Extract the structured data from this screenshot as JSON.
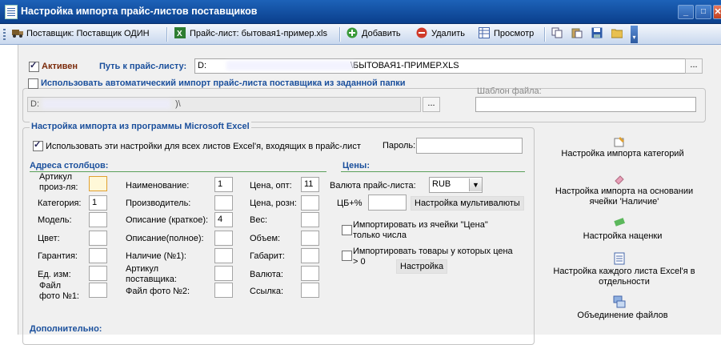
{
  "window": {
    "title": "Настройка импорта прайс-листов поставщиков",
    "buttons": [
      "_",
      "□",
      "✕"
    ]
  },
  "toolbar": {
    "supplier": "Поставщик: Поставщик ОДИН",
    "pricelist": "Прайс-лист: бытовая1-пример.xls",
    "add": "Добавить",
    "delete": "Удалить",
    "preview": "Просмотр"
  },
  "top": {
    "active_label": "Активен",
    "path_label": "Путь к прайс-листу:",
    "path_value_prefix": "D:",
    "path_value_suffix": "\\БЫТОВАЯ1-ПРИМЕР.XLS",
    "browse": "...",
    "auto_import_label": "Использовать автоматический импорт прайс-листа поставщика из заданной папки",
    "folder_value_prefix": "D:",
    "folder_value_suffix": ")\\",
    "template_label": "Шаблон файла:"
  },
  "excel": {
    "group_title": "Настройка импорта из программы Microsoft Excel",
    "use_all_label": "Использовать эти настройки для всех листов Excel'я, входящих в прайс-лист",
    "password_label": "Пароль:",
    "columns_title": "Адреса столбцов:",
    "fields": [
      {
        "label": "Артикул произ-ля:",
        "value": ""
      },
      {
        "label": "Категория:",
        "value": "1"
      },
      {
        "label": "Модель:",
        "value": ""
      },
      {
        "label": "Цвет:",
        "value": ""
      },
      {
        "label": "Гарантия:",
        "value": ""
      },
      {
        "label": "Ед. изм:",
        "value": ""
      },
      {
        "label": "Файл фото №1:",
        "value": ""
      },
      {
        "label": "Наименование:",
        "value": "1"
      },
      {
        "label": "Производитель:",
        "value": ""
      },
      {
        "label": "Описание (краткое):",
        "value": "4"
      },
      {
        "label": "Описание(полное):",
        "value": ""
      },
      {
        "label": "Наличие (№1):",
        "value": ""
      },
      {
        "label": "Артикул поставщика:",
        "value": ""
      },
      {
        "label": "Файл фото №2:",
        "value": ""
      },
      {
        "label": "Цена, опт:",
        "value": "11"
      },
      {
        "label": "Цена, розн:",
        "value": ""
      },
      {
        "label": "Вес:",
        "value": ""
      },
      {
        "label": "Объем:",
        "value": ""
      },
      {
        "label": "Габарит:",
        "value": ""
      },
      {
        "label": "Валюта:",
        "value": ""
      },
      {
        "label": "Ссылка:",
        "value": ""
      }
    ],
    "prices_title": "Цены:",
    "currency_label": "Валюта прайс-листа:",
    "currency_value": "RUB",
    "cb_label": "ЦБ+%",
    "multicurrency_button": "Настройка мультивалюты",
    "import_numbers_label": "Импортировать из ячейки \"Цена\" только числа",
    "import_positive_label": "Импортировать товары у которых цена > 0",
    "settings_button": "Настройка",
    "extra_title": "Дополнительно:"
  },
  "side": {
    "categories": "Настройка импорта категорий",
    "availability": "Настройка импорта на основании ячейки 'Наличие'",
    "markup": "Настройка наценки",
    "each_sheet": "Настройка каждого листа Excel'я в отдельности",
    "merge": "Объединение файлов"
  },
  "colors": {
    "title_bar": "#0a3f8c",
    "accent_blue": "#1a4f9c",
    "focus_field": "#fff8d8"
  }
}
